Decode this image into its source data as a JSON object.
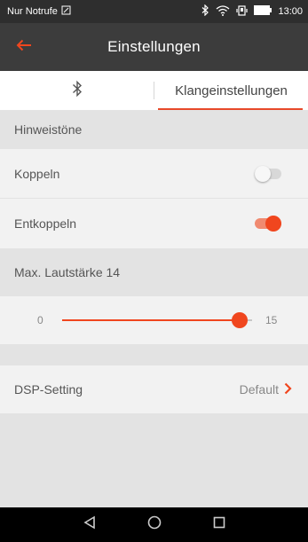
{
  "status_bar": {
    "carrier": "Nur Notrufe",
    "time": "13:00",
    "icons": [
      "sim-icon",
      "bluetooth-icon",
      "wifi-icon",
      "vibrate-icon",
      "battery-icon"
    ]
  },
  "app_bar": {
    "title": "Einstellungen",
    "back_icon": "arrow-left-icon"
  },
  "tabs": [
    {
      "label": "",
      "icon": "bluetooth-icon",
      "active": false
    },
    {
      "label": "Klangeinstellungen",
      "active": true
    }
  ],
  "sections": {
    "tones_header": "Hinweistöne",
    "couple_label": "Koppeln",
    "couple_on": false,
    "decouple_label": "Entkoppeln",
    "decouple_on": true,
    "volume_header": "Max. Lautstärke 14",
    "volume": {
      "min": "0",
      "max": "15",
      "value": 14,
      "range": [
        0,
        15
      ]
    },
    "dsp_label": "DSP-Setting",
    "dsp_value": "Default"
  },
  "nav_bar": {
    "icons": [
      "back-triangle-icon",
      "home-circle-icon",
      "recents-square-icon"
    ]
  },
  "colors": {
    "accent": "#f0461e",
    "app_bar": "#3c3c3c",
    "status_bar": "#2e2e2e"
  }
}
